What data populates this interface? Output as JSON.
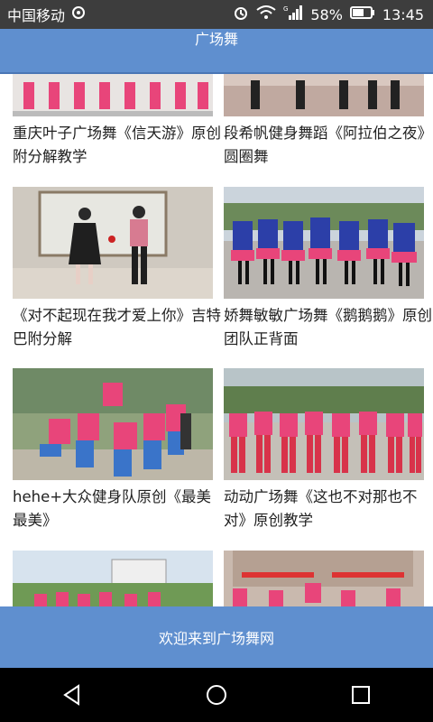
{
  "status_bar": {
    "carrier": "中国移动",
    "battery": "58%",
    "time": "13:45",
    "network": "G"
  },
  "header": {
    "title": "广场舞"
  },
  "videos": [
    {
      "title": "重庆叶子广场舞《信天游》原创附分解教学"
    },
    {
      "title": "段希帆健身舞蹈《阿拉伯之夜》圆圈舞"
    },
    {
      "title": "《对不起现在我才爱上你》吉特巴附分解"
    },
    {
      "title": "娇舞敏敏广场舞《鹅鹅鹅》原创团队正背面"
    },
    {
      "title": "hehe+大众健身队原创《最美最美》"
    },
    {
      "title": "动动广场舞《这也不对那也不对》原创教学"
    },
    {
      "title": ""
    },
    {
      "title": ""
    }
  ],
  "bottom_bar": {
    "label": "欢迎来到广场舞网"
  },
  "colors": {
    "accent": "#5f8fcf",
    "status_bar": "#3d3d3d",
    "nav_bar": "#000000"
  }
}
